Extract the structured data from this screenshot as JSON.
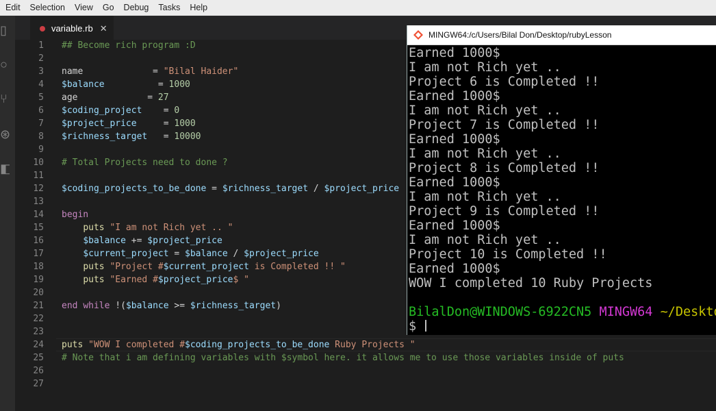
{
  "menu": [
    "Edit",
    "Selection",
    "View",
    "Go",
    "Debug",
    "Tasks",
    "Help"
  ],
  "activity_icons": [
    "files-icon",
    "search-icon",
    "source-control-icon",
    "debug-icon",
    "extensions-icon"
  ],
  "tab": {
    "label": "variable.rb",
    "close": "✕"
  },
  "editor": {
    "line_numbers": [
      "1",
      "2",
      "3",
      "4",
      "5",
      "6",
      "7",
      "8",
      "9",
      "10",
      "11",
      "12",
      "13",
      "14",
      "15",
      "16",
      "17",
      "18",
      "19",
      "20",
      "21",
      "22",
      "23",
      "24",
      "25",
      "26",
      "27"
    ],
    "lines": [
      [
        [
          "c",
          "## Become rich program :D"
        ]
      ],
      [],
      [
        [
          "p",
          "name             = "
        ],
        [
          "s",
          "\"Bilal Haider\""
        ]
      ],
      [
        [
          "v",
          "$balance"
        ],
        [
          "p",
          "          = "
        ],
        [
          "n",
          "1000"
        ]
      ],
      [
        [
          "p",
          "age             = "
        ],
        [
          "n",
          "27"
        ]
      ],
      [
        [
          "v",
          "$coding_project"
        ],
        [
          "p",
          "    = "
        ],
        [
          "n",
          "0"
        ]
      ],
      [
        [
          "v",
          "$project_price"
        ],
        [
          "p",
          "     = "
        ],
        [
          "n",
          "1000"
        ]
      ],
      [
        [
          "v",
          "$richness_target"
        ],
        [
          "p",
          "   = "
        ],
        [
          "n",
          "10000"
        ]
      ],
      [],
      [
        [
          "c",
          "# Total Projects need to done ?"
        ]
      ],
      [],
      [
        [
          "v",
          "$coding_projects_to_be_done"
        ],
        [
          "p",
          " = "
        ],
        [
          "v",
          "$richness_target"
        ],
        [
          "p",
          " / "
        ],
        [
          "v",
          "$project_price"
        ]
      ],
      [],
      [
        [
          "k",
          "begin"
        ]
      ],
      [
        [
          "p",
          "    "
        ],
        [
          "f",
          "puts"
        ],
        [
          "p",
          " "
        ],
        [
          "s",
          "\"I am not Rich yet .. \""
        ]
      ],
      [
        [
          "p",
          "    "
        ],
        [
          "v",
          "$balance"
        ],
        [
          "p",
          " += "
        ],
        [
          "v",
          "$project_price"
        ]
      ],
      [
        [
          "p",
          "    "
        ],
        [
          "v",
          "$current_project"
        ],
        [
          "p",
          " = "
        ],
        [
          "v",
          "$balance"
        ],
        [
          "p",
          " / "
        ],
        [
          "v",
          "$project_price"
        ]
      ],
      [
        [
          "p",
          "    "
        ],
        [
          "f",
          "puts"
        ],
        [
          "p",
          " "
        ],
        [
          "s",
          "\"Project #"
        ],
        [
          "v",
          "$current_project"
        ],
        [
          "s",
          " is Completed !! \""
        ]
      ],
      [
        [
          "p",
          "    "
        ],
        [
          "f",
          "puts"
        ],
        [
          "p",
          " "
        ],
        [
          "s",
          "\"Earned #"
        ],
        [
          "v",
          "$project_price"
        ],
        [
          "s",
          "$ \""
        ]
      ],
      [],
      [
        [
          "k",
          "end"
        ],
        [
          "p",
          " "
        ],
        [
          "k",
          "while"
        ],
        [
          "p",
          " !("
        ],
        [
          "v",
          "$balance"
        ],
        [
          "p",
          " >= "
        ],
        [
          "v",
          "$richness_target"
        ],
        [
          "p",
          ")"
        ]
      ],
      [],
      [],
      [
        [
          "f",
          "puts"
        ],
        [
          "p",
          " "
        ],
        [
          "s",
          "\"WOW I completed #"
        ],
        [
          "v",
          "$coding_projects_to_be_done"
        ],
        [
          "s",
          " Ruby Projects \""
        ]
      ],
      [
        [
          "c",
          "# Note that i am defining variables with $symbol here. it allows me to use those variables inside of puts"
        ]
      ],
      [],
      []
    ]
  },
  "terminal": {
    "title": "MINGW64:/c/Users/Bilal Don/Desktop/rubyLesson",
    "lines": [
      "Earned 1000$",
      "I am not Rich yet ..",
      "Project 6 is Completed !!",
      "Earned 1000$",
      "I am not Rich yet ..",
      "Project 7 is Completed !!",
      "Earned 1000$",
      "I am not Rich yet ..",
      "Project 8 is Completed !!",
      "Earned 1000$",
      "I am not Rich yet ..",
      "Project 9 is Completed !!",
      "Earned 1000$",
      "I am not Rich yet ..",
      "Project 10 is Completed !!",
      "Earned 1000$",
      "WOW I completed 10 Ruby Projects",
      ""
    ],
    "prompt": {
      "user": "BilalDon@WINDOWS-6922CN5",
      "shell": "MINGW64",
      "path": "~/Desktop/rubyLesson"
    },
    "input_prompt": "$ "
  },
  "colors": {
    "comment": "#6a9955",
    "string": "#ce9178",
    "variable": "#9cdcfe",
    "number": "#b5cea8",
    "keyword": "#c586c0",
    "prompt_user": "#25bc24",
    "prompt_shell": "#d338d3",
    "prompt_path": "#c7c400"
  }
}
